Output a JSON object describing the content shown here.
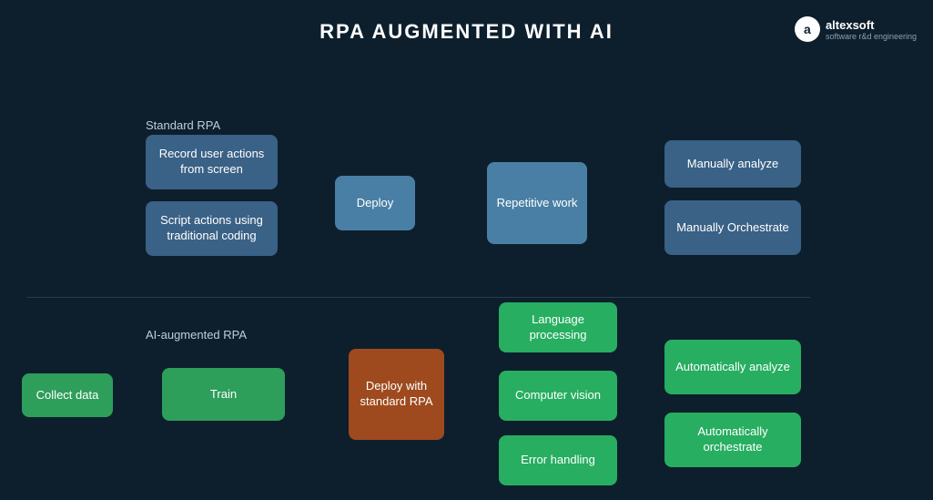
{
  "title": "RPA AUGMENTED WITH AI",
  "section_standard": "Standard RPA",
  "section_ai": "AI-augmented RPA",
  "boxes": {
    "record_actions": "Record user actions from screen",
    "script_actions": "Script actions using traditional coding",
    "deploy": "Deploy",
    "repetitive_work": "Repetitive work",
    "manually_analyze": "Manually analyze",
    "manually_orchestrate": "Manually Orchestrate",
    "collect_data": "Collect data",
    "train": "Train",
    "deploy_standard": "Deploy with standard RPA",
    "language_processing": "Language processing",
    "computer_vision": "Computer vision",
    "error_handling": "Error handling",
    "auto_analyze": "Automatically analyze",
    "auto_orchestrate": "Automatically orchestrate"
  },
  "logo": {
    "symbol": "a",
    "name": "altexsoft",
    "subtitle": "software r&d engineering"
  },
  "colors": {
    "bg": "#0d1f2d",
    "blue_dark": "#3a6186",
    "blue_mid": "#4a7fa5",
    "green": "#27ae60",
    "brown": "#9e4a1e",
    "white": "#ffffff"
  }
}
